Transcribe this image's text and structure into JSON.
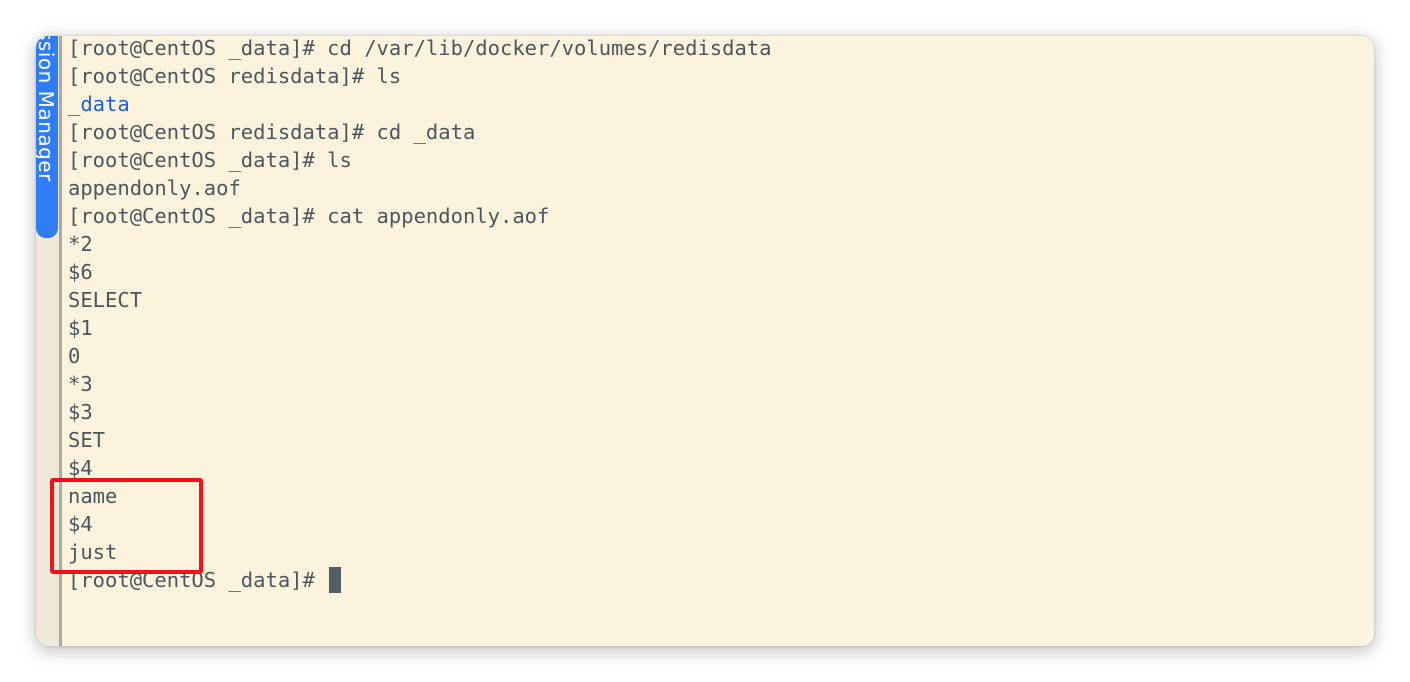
{
  "sidebar": {
    "tab_label": "ssion Manager"
  },
  "terminal": {
    "lines": [
      {
        "text": "[root@CentOS _data]# cd /var/lib/docker/volumes/redisdata",
        "kind": "prompt"
      },
      {
        "text": "[root@CentOS redisdata]# ls",
        "kind": "prompt"
      },
      {
        "text": "_data",
        "kind": "directory"
      },
      {
        "text": "[root@CentOS redisdata]# cd _data",
        "kind": "prompt"
      },
      {
        "text": "[root@CentOS _data]# ls",
        "kind": "prompt"
      },
      {
        "text": "appendonly.aof",
        "kind": "output"
      },
      {
        "text": "[root@CentOS _data]# cat appendonly.aof",
        "kind": "prompt"
      },
      {
        "text": "*2",
        "kind": "output"
      },
      {
        "text": "$6",
        "kind": "output"
      },
      {
        "text": "SELECT",
        "kind": "output"
      },
      {
        "text": "$1",
        "kind": "output"
      },
      {
        "text": "0",
        "kind": "output"
      },
      {
        "text": "*3",
        "kind": "output"
      },
      {
        "text": "$3",
        "kind": "output"
      },
      {
        "text": "SET",
        "kind": "output"
      },
      {
        "text": "$4",
        "kind": "output"
      },
      {
        "text": "name",
        "kind": "output"
      },
      {
        "text": "$4",
        "kind": "output"
      },
      {
        "text": "just",
        "kind": "output"
      }
    ],
    "current_prompt": "[root@CentOS _data]# "
  },
  "colors": {
    "background": "#fcf3dc",
    "text": "#4b5760",
    "directory": "#1860d8",
    "tab": "#2f7cf6",
    "highlight": "#f4101a",
    "cursor": "#4f5f6a"
  }
}
